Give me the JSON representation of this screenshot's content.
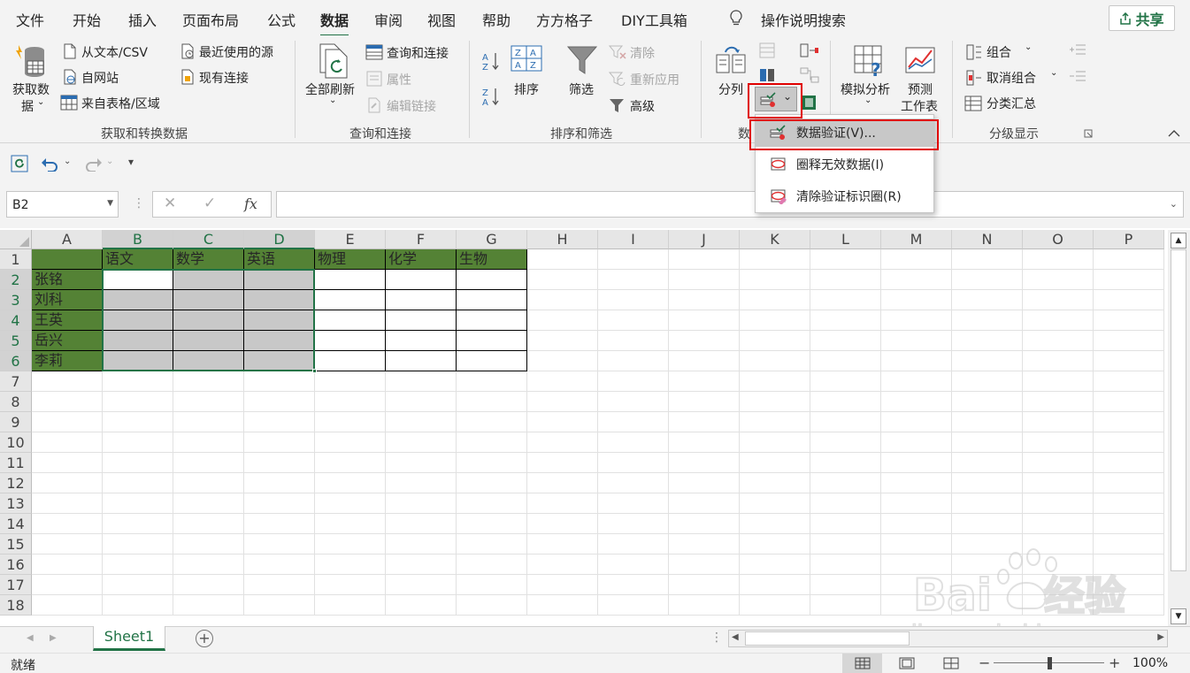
{
  "tabs": [
    "文件",
    "开始",
    "插入",
    "页面布局",
    "公式",
    "数据",
    "审阅",
    "视图",
    "帮助",
    "方方格子",
    "DIY工具箱"
  ],
  "tell_me": "操作说明搜索",
  "share": "共享",
  "ribbon": {
    "get_transform": {
      "get_data": [
        "获取数",
        "据"
      ],
      "from_text": "从文本/CSV",
      "from_web": "自网站",
      "from_table": "来自表格/区域",
      "recent": "最近使用的源",
      "existing": "现有连接",
      "label": "获取和转换数据"
    },
    "queries": {
      "refresh_all": "全部刷新",
      "queries_connections": "查询和连接",
      "properties": "属性",
      "edit_links": "编辑链接",
      "label": "查询和连接"
    },
    "sort_filter": {
      "sort": "排序",
      "filter": "筛选",
      "clear": "清除",
      "reapply": "重新应用",
      "advanced": "高级",
      "label": "排序和筛选"
    },
    "data_tools": {
      "text_to_columns": "分列",
      "label_partial": "数"
    },
    "forecast": {
      "what_if": "模拟分析",
      "forecast_sheet": [
        "预测",
        "工作表"
      ]
    },
    "outline": {
      "group": "组合",
      "ungroup": "取消组合",
      "subtotal": "分类汇总",
      "label": "分级显示"
    }
  },
  "dropdown_menu": {
    "items": [
      "数据验证(V)...",
      "圈释无效数据(I)",
      "清除验证标识圈(R)"
    ]
  },
  "formula_bar": {
    "name_box": "B2",
    "fx": "fx",
    "value": ""
  },
  "sheet": {
    "columns": [
      "A",
      "B",
      "C",
      "D",
      "E",
      "F",
      "G",
      "H",
      "I",
      "J",
      "K",
      "L",
      "M",
      "N",
      "O",
      "P"
    ],
    "rows": [
      "1",
      "2",
      "3",
      "4",
      "5",
      "6",
      "7",
      "8",
      "9",
      "10",
      "11",
      "12",
      "13",
      "14",
      "15",
      "16",
      "17",
      "18"
    ],
    "header_row": [
      "",
      "语文",
      "数学",
      "英语",
      "物理",
      "化学",
      "生物"
    ],
    "names": [
      "张铭",
      "刘科",
      "王英",
      "岳兴",
      "李莉"
    ]
  },
  "sheet_tabs": [
    "Sheet1"
  ],
  "status": {
    "ready": "就绪",
    "zoom": "100%",
    "zoom_level": 1.0
  },
  "colors": {
    "accent": "#217346",
    "header_fill": "#548235",
    "selection_fill": "#c8c8c8",
    "highlight": "#e00000"
  },
  "watermark": "Baidu经验 jingyan.baidu.com"
}
